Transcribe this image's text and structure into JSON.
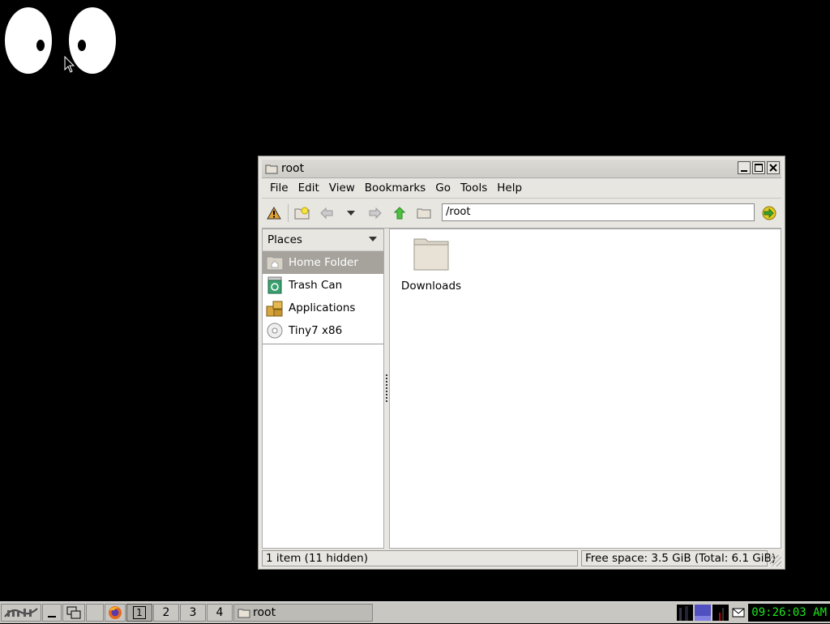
{
  "window": {
    "title": "root",
    "menu": [
      "File",
      "Edit",
      "View",
      "Bookmarks",
      "Go",
      "Tools",
      "Help"
    ],
    "path": "/root",
    "places_header": "Places",
    "places": [
      {
        "label": "Home Folder",
        "icon": "home-folder-icon",
        "selected": true
      },
      {
        "label": "Trash Can",
        "icon": "trash-icon",
        "selected": false
      },
      {
        "label": "Applications",
        "icon": "applications-icon",
        "selected": false
      },
      {
        "label": "Tiny7 x86",
        "icon": "disc-icon",
        "selected": false
      }
    ],
    "files": [
      {
        "name": "Downloads",
        "icon": "folder-icon"
      }
    ],
    "status_left": "1 item (11 hidden)",
    "status_right": "Free space: 3.5 GiB (Total: 6.1 GiB)"
  },
  "taskbar": {
    "desktops": [
      "1",
      "2",
      "3",
      "4"
    ],
    "task": "root",
    "clock": "09:26:03 AM"
  },
  "colors": {
    "desktop": "#000000",
    "selection": "#a6a39d",
    "clock": "#1ee61e"
  }
}
